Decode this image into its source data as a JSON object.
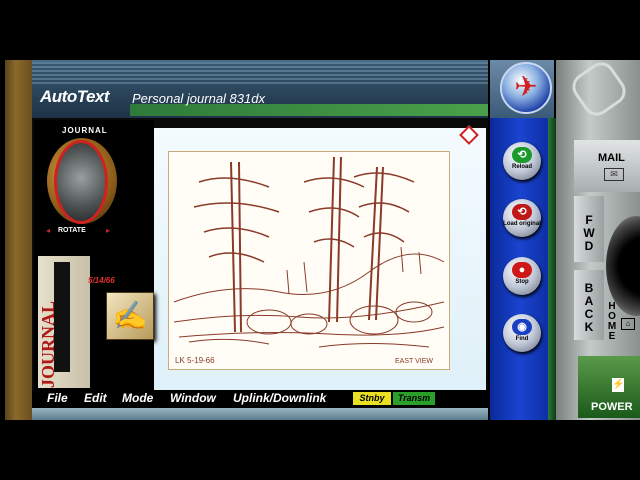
{
  "window": {
    "app_title": "AutoText",
    "app_subtitle": "Personal journal 831dx"
  },
  "sidebar": {
    "journal_caption": "JOURNAL",
    "rotate_label": "ROTATE",
    "rotate_left_glyph": "◂",
    "rotate_right_glyph": "▸",
    "entry_date": "5/14/66",
    "journal_book_label": "JOURNAL",
    "pen_icon": "pen-write-icon",
    "pen_glyph": "✍"
  },
  "sketch": {
    "signature": "LK 5-19-66",
    "caption": "EAST VIEW"
  },
  "menu": {
    "items": [
      "File",
      "Edit",
      "Mode",
      "Window",
      "Uplink/Downlink"
    ]
  },
  "status": {
    "standby": "Stnby",
    "transmit": "Transm",
    "standby_color": "#e8e020",
    "transmit_color": "#2aa02a"
  },
  "toolbar": {
    "reload": "Reload",
    "load_original": "Load original",
    "stop": "Stop",
    "find": "Find",
    "reload_glyph": "⟲",
    "load_glyph": "⟲",
    "stop_glyph": "●",
    "find_glyph": "◉"
  },
  "side_panel": {
    "mail": "MAIL",
    "mail_glyph": "✉",
    "fwd": "FWD",
    "back": "BACK",
    "home": "HOME",
    "home_glyph": "⌂",
    "power": "POWER",
    "power_glyph": "⚡"
  },
  "logo_glyph": "✈"
}
